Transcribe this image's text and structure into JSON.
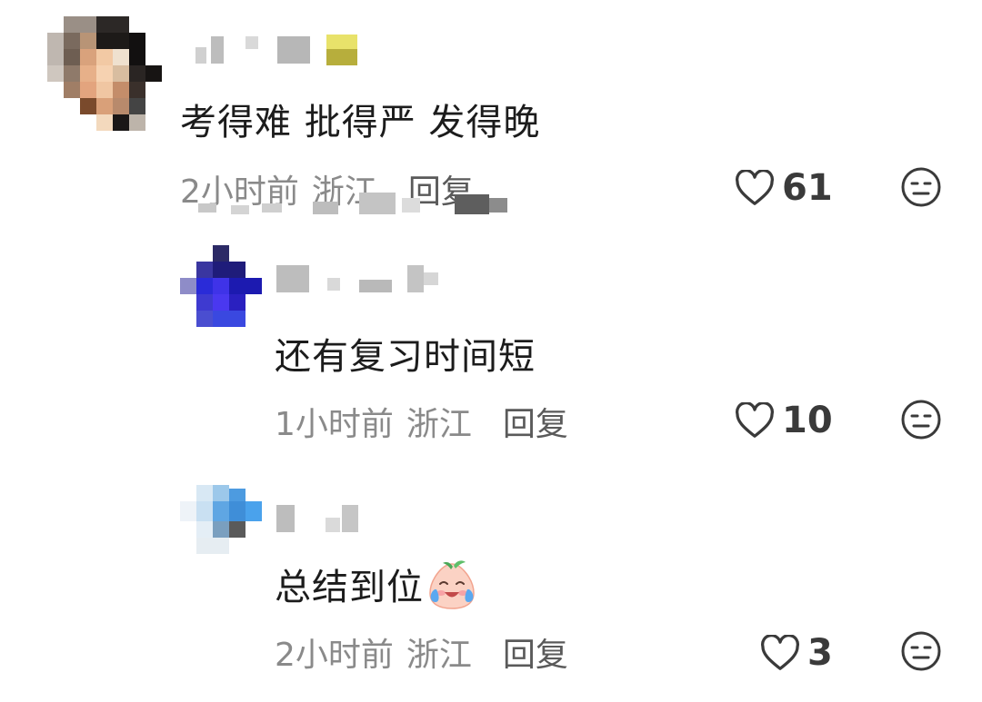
{
  "comments": [
    {
      "text": "考得难 批得严 发得晚",
      "time": "2小时前",
      "location": "浙江",
      "reply_label": "回复",
      "likes": "61",
      "emoji": ""
    },
    {
      "text": "还有复习时间短",
      "time": "1小时前",
      "location": "浙江",
      "reply_label": "回复",
      "likes": "10",
      "emoji": ""
    },
    {
      "text": "总结到位",
      "time": "2小时前",
      "location": "浙江",
      "reply_label": "回复",
      "likes": "3",
      "emoji": "crying-laughing-peach-emoji"
    }
  ],
  "colors": {
    "text": "#1c1c1c",
    "meta": "#8a8a8a",
    "reply": "#5a5a5a",
    "icon": "#3a3a3a"
  },
  "icons": {
    "like": "heart-outline-icon",
    "dislike": "neutral-face-icon"
  }
}
